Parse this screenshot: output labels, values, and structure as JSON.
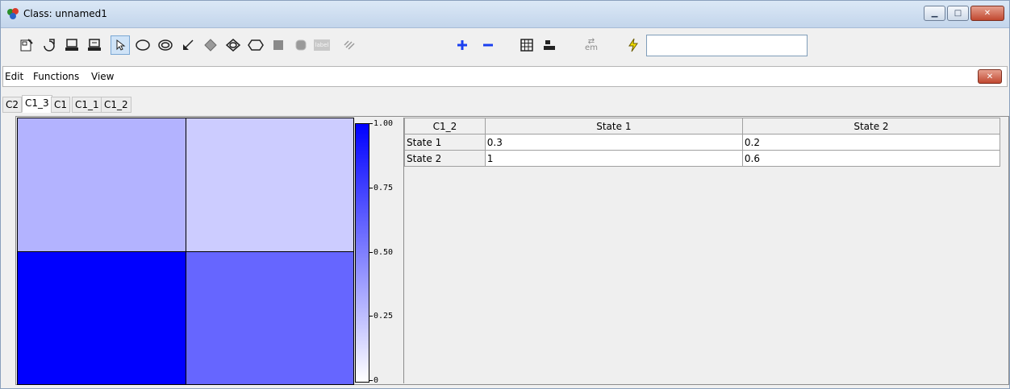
{
  "window": {
    "title": "Class: unnamed1"
  },
  "menu": [
    "Edit",
    "Functions",
    "View"
  ],
  "tabs": [
    "C2",
    "C1_3",
    "C1",
    "C1_1",
    "C1_2"
  ],
  "selected_tab": "C1_3",
  "toolbar": {
    "icons": [
      "properties-icon",
      "open-icon",
      "computer-icon",
      "network-icon",
      "pointer-icon",
      "ellipse-icon",
      "double-ellipse-icon",
      "arrow-icon",
      "diamond-icon",
      "double-diamond-icon",
      "hexagon-icon",
      "square-icon",
      "rounded-square-icon",
      "label-icon",
      "wave-icon",
      "plus-icon",
      "minus-icon",
      "grid-icon",
      "table-icon",
      "em-icon",
      "lightning-icon"
    ],
    "label_text": "label",
    "em_text": "em",
    "input_value": ""
  },
  "colorbar": {
    "ticks": [
      "1.00",
      "0.75",
      "0.50",
      "0.25",
      "0"
    ]
  },
  "heatmap": {
    "values": [
      [
        0.3,
        0.2
      ],
      [
        1,
        0.6
      ]
    ]
  },
  "table": {
    "corner": "C1_2",
    "columns": [
      "State 1",
      "State 2"
    ],
    "rows": [
      {
        "label": "State 1",
        "values": [
          "0.3",
          "0.2"
        ]
      },
      {
        "label": "State 2",
        "values": [
          "1",
          "0.6"
        ]
      }
    ]
  },
  "colors": {
    "titlebar": "#c3d5eb",
    "accent": "#0000ff"
  }
}
